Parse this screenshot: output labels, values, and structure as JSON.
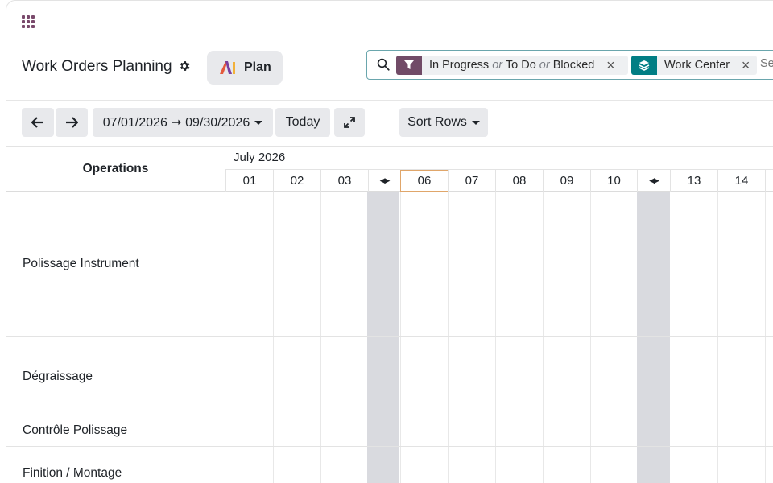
{
  "topbar": {
    "apps_icon": "grid-icon"
  },
  "control": {
    "title": "Work Orders Planning",
    "settings_icon": "gear-icon",
    "plan_label": "Plan"
  },
  "search": {
    "filter_facet": {
      "parts": [
        "In Progress",
        "or",
        "To Do",
        "or",
        "Blocked"
      ]
    },
    "group_facet": {
      "label": "Work Center"
    },
    "placeholder": "Search..."
  },
  "toolbar": {
    "range_label": "07/01/2026 ➞ 09/30/2026",
    "today_label": "Today",
    "sort_label": "Sort Rows"
  },
  "gantt": {
    "column_header": "Operations",
    "month": "July 2026",
    "days": [
      "01",
      "02",
      "03",
      "06",
      "07",
      "08",
      "09",
      "10",
      "13",
      "14"
    ],
    "today": "06",
    "rows": [
      {
        "label": "Polissage Instrument"
      },
      {
        "label": "Dégraissage"
      },
      {
        "label": "Contrôle Polissage"
      },
      {
        "label": "Finition / Montage"
      }
    ]
  },
  "colors": {
    "accent": "#714b67",
    "group": "#017e84",
    "today_border": "#e0a66a",
    "folded": "#d9dadf"
  }
}
